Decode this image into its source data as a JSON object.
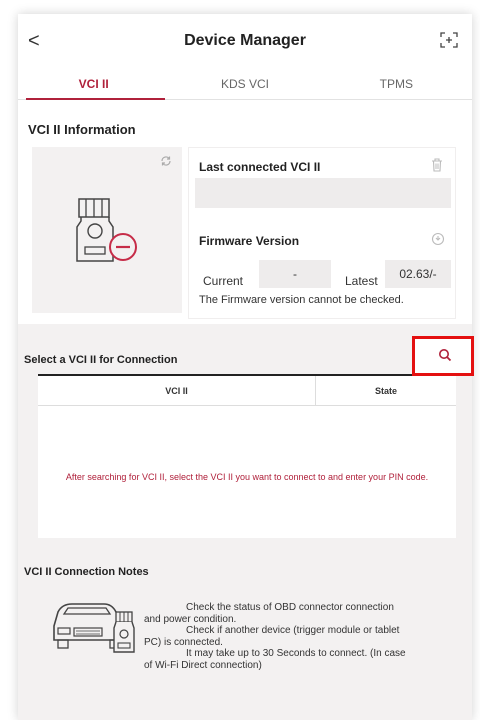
{
  "header": {
    "back_label": "<",
    "title": "Device Manager"
  },
  "tabs": [
    {
      "label": "VCI II",
      "active": true
    },
    {
      "label": "KDS VCI",
      "active": false
    },
    {
      "label": "TPMS",
      "active": false
    }
  ],
  "vci_info": {
    "section_title": "VCI II Information",
    "last_connected_label": "Last connected VCI II",
    "last_connected_value": "",
    "firmware_label": "Firmware Version",
    "current_label": "Current",
    "current_value": "-",
    "latest_label": "Latest",
    "latest_value": "02.63/-",
    "firmware_message": "The Firmware version cannot be checked."
  },
  "connection": {
    "section_title": "Select a VCI II for Connection",
    "columns": [
      "VCI II",
      "State"
    ],
    "empty_message": "After searching for VCI II, select the VCI II you want to connect to and enter your PIN code."
  },
  "notes": {
    "title": "VCI II Connection Notes",
    "lines": [
      "Check the status of OBD connector connection",
      "and power condition.",
      "Check if another device (trigger module or tablet",
      "PC) is connected.",
      "It may take up to 30 Seconds to connect. (In case",
      "of Wi-Fi Direct connection)"
    ]
  },
  "icons": {
    "back": "chevron-left-icon",
    "scan": "scan-icon",
    "refresh": "refresh-icon",
    "trash": "trash-icon",
    "firmware_update": "update-icon",
    "search": "search-icon",
    "device": "vci-device-icon",
    "car": "car-connection-icon"
  },
  "colors": {
    "accent": "#b0213b",
    "highlight": "#e41010",
    "panel_bg": "#f3f1f1",
    "field_bg": "#eeecec"
  }
}
